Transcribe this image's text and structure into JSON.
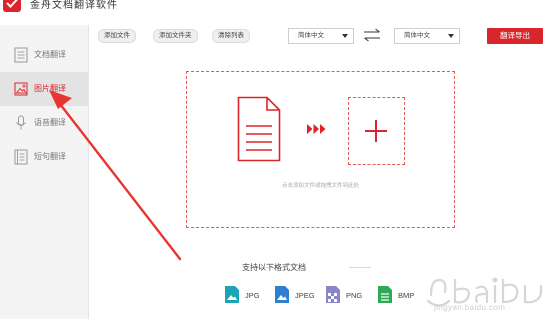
{
  "app": {
    "title": "金舟文档翻译软件"
  },
  "sidebar": {
    "items": [
      {
        "label": "文档翻译",
        "icon": "document-icon",
        "active": false
      },
      {
        "label": "图片翻译",
        "icon": "image-icon",
        "active": true
      },
      {
        "label": "语音翻译",
        "icon": "microphone-icon",
        "active": false
      },
      {
        "label": "短句翻译",
        "icon": "note-icon",
        "active": false
      }
    ]
  },
  "toolbar": {
    "add_file": "添加文件",
    "add_folder": "添加文件夹",
    "clear_list": "清除列表",
    "source_lang": "简体中文",
    "target_lang": "简体中文",
    "export": "翻译导出"
  },
  "dropzone": {
    "hint": "点击添加文件或拖拽文件到此处"
  },
  "formats": {
    "title": "支持以下格式文档",
    "items": [
      {
        "label": "JPG",
        "color": "#1aa4b6"
      },
      {
        "label": "JPEG",
        "color": "#2f7fd1"
      },
      {
        "label": "PNG",
        "color": "#8a84c8"
      },
      {
        "label": "BMP",
        "color": "#2eaa56"
      }
    ]
  },
  "colors": {
    "accent": "#d8262c",
    "sidebar_bg": "#f4f4f4"
  },
  "watermark": {
    "url": "jingyan.baidu.com"
  }
}
